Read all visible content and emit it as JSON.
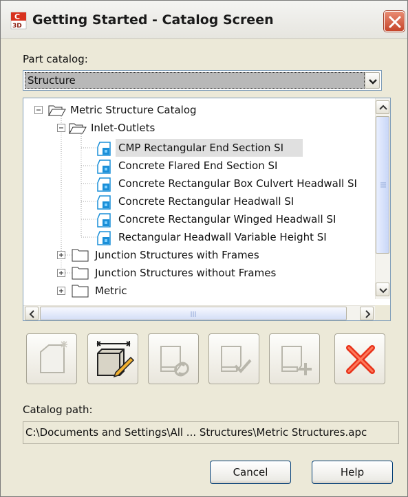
{
  "window": {
    "title": "Getting Started - Catalog Screen"
  },
  "part_catalog": {
    "label": "Part catalog:",
    "selected": "Structure"
  },
  "tree": {
    "items": [
      {
        "label": "Metric Structure Catalog",
        "type": "folder-open",
        "expander": "minus"
      },
      {
        "label": "Inlet-Outlets",
        "type": "folder-open",
        "expander": "minus"
      },
      {
        "label": "CMP Rectangular End Section SI",
        "type": "part",
        "selected": true
      },
      {
        "label": "Concrete Flared End Section SI",
        "type": "part"
      },
      {
        "label": "Concrete Rectangular Box Culvert Headwall SI",
        "type": "part"
      },
      {
        "label": "Concrete Rectangular Headwall SI",
        "type": "part"
      },
      {
        "label": "Concrete Rectangular Winged Headwall SI",
        "type": "part"
      },
      {
        "label": "Rectangular Headwall Variable Height SI",
        "type": "part"
      },
      {
        "label": "Junction Structures with Frames",
        "type": "folder",
        "expander": "plus"
      },
      {
        "label": "Junction Structures without Frames",
        "type": "folder",
        "expander": "plus"
      },
      {
        "label": "Metric",
        "type": "folder",
        "expander": "plus"
      }
    ]
  },
  "toolbar": {
    "buttons": [
      {
        "name": "new-part-icon",
        "enabled": false
      },
      {
        "name": "edit-part-size-icon",
        "enabled": true
      },
      {
        "name": "regenerate-part-icon",
        "enabled": false
      },
      {
        "name": "validate-part-icon",
        "enabled": false
      },
      {
        "name": "add-part-icon",
        "enabled": false
      },
      {
        "name": "delete-part-icon",
        "enabled": true
      }
    ]
  },
  "catalog_path": {
    "label": "Catalog path:",
    "value": "C:\\Documents and Settings\\All ... Structures\\Metric Structures.apc"
  },
  "buttons": {
    "cancel": "Cancel",
    "help": "Help"
  },
  "colors": {
    "close_red": "#c6452a",
    "delete_red": "#e8341c",
    "part_icon_blue": "#1a8fd8"
  }
}
